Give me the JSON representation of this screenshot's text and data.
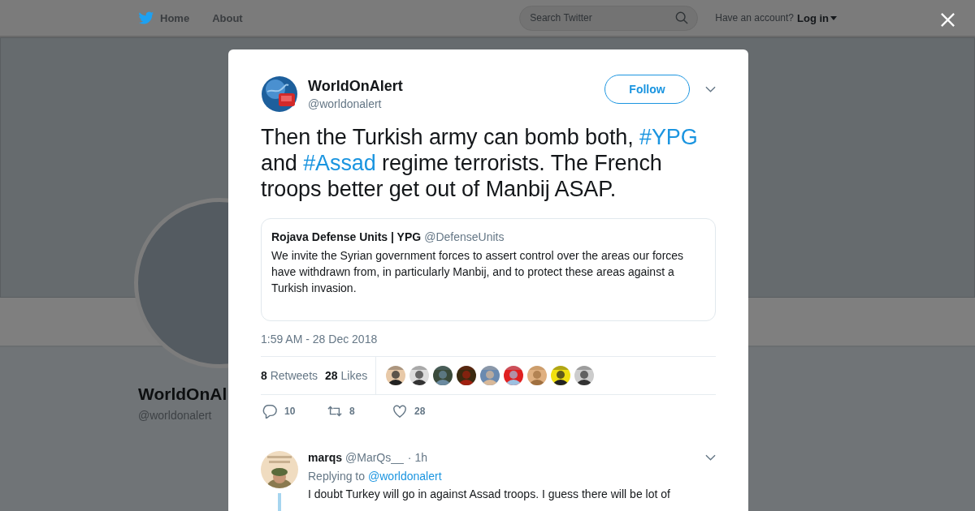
{
  "top_bar": {
    "nav": [
      {
        "label": "Home",
        "kind": "home"
      },
      {
        "label": "About",
        "kind": "plain"
      }
    ],
    "search": {
      "placeholder": "Search Twitter"
    },
    "account_prompt": "Have an account?",
    "login": "Log in"
  },
  "profile": {
    "name": "WorldOnAl",
    "handle": "@worldonalert"
  },
  "tweet": {
    "author": {
      "name": "WorldOnAlert",
      "handle": "@worldonalert"
    },
    "follow_button": "Follow",
    "text": [
      {
        "kind": "text",
        "text": "Then the Turkish army can bomb both, "
      },
      {
        "kind": "hashtag",
        "text": "#YPG"
      },
      {
        "kind": "text",
        "text": " and "
      },
      {
        "kind": "hashtag",
        "text": "#Assad"
      },
      {
        "kind": "text",
        "text": " regime terrorists. The French troops better get out of Manbij ASAP."
      }
    ],
    "quoted": {
      "name": "Rojava Defense Units | YPG",
      "handle": "@DefenseUnits",
      "text": "We invite the Syrian government forces to assert control over the areas our forces have withdrawn from, in particularly Manbij, and to protect these areas against a Turkish invasion."
    },
    "timestamp": "1:59 AM - 28 Dec 2018",
    "stats": [
      {
        "count": "8",
        "label": "Retweets"
      },
      {
        "count": "28",
        "label": "Likes"
      }
    ],
    "actions": [
      {
        "kind": "reply",
        "count": "10"
      },
      {
        "kind": "retweet",
        "count": "8"
      },
      {
        "kind": "like",
        "count": "28"
      }
    ]
  },
  "replies": [
    {
      "name": "marqs",
      "handle": "@MarQs__",
      "time": "· 1h",
      "replying_to_label": "Replying to",
      "replying_to": "@worldonalert",
      "text": "I doubt Turkey will go in against Assad troops. I guess there will be lot of"
    }
  ]
}
